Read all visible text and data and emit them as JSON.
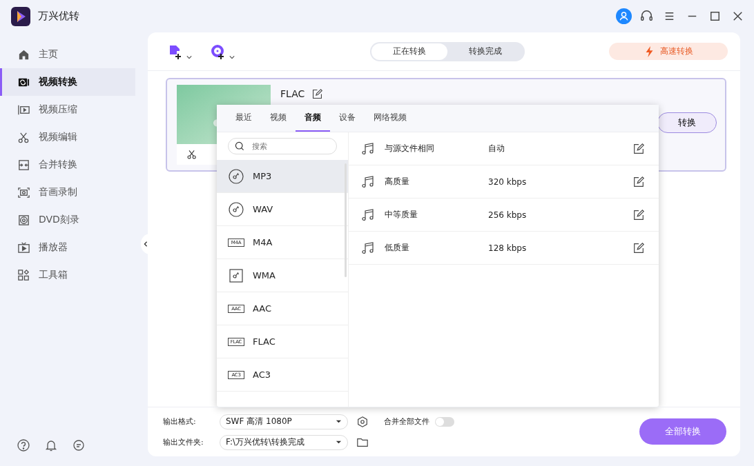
{
  "window": {
    "title": "万兴优转"
  },
  "sidebar": {
    "items": [
      {
        "label": "主页",
        "selected": false
      },
      {
        "label": "视频转换",
        "selected": true
      },
      {
        "label": "视频压缩",
        "selected": false
      },
      {
        "label": "视频编辑",
        "selected": false
      },
      {
        "label": "合并转换",
        "selected": false
      },
      {
        "label": "音画录制",
        "selected": false
      },
      {
        "label": "DVD刻录",
        "selected": false
      },
      {
        "label": "播放器",
        "selected": false
      },
      {
        "label": "工具箱",
        "selected": false
      }
    ]
  },
  "segments": [
    {
      "label": "正在转换",
      "selected": true
    },
    {
      "label": "转换完成",
      "selected": false
    }
  ],
  "turbo_button": "高速转换",
  "file_card": {
    "format": "FLAC",
    "convert_button": "转换"
  },
  "format_popup": {
    "tabs": [
      {
        "label": "最近",
        "selected": false
      },
      {
        "label": "视频",
        "selected": false
      },
      {
        "label": "音频",
        "selected": true
      },
      {
        "label": "设备",
        "selected": false
      },
      {
        "label": "网络视频",
        "selected": false
      }
    ],
    "search": {
      "placeholder": "搜索"
    },
    "formats": [
      {
        "label": "MP3",
        "kind": "disc",
        "selected": true
      },
      {
        "label": "WAV",
        "kind": "disc",
        "selected": false
      },
      {
        "label": "M4A",
        "kind": "tag",
        "tag": "M4A",
        "selected": false
      },
      {
        "label": "WMA",
        "kind": "square",
        "selected": false
      },
      {
        "label": "AAC",
        "kind": "tag",
        "tag": "AAC",
        "selected": false
      },
      {
        "label": "FLAC",
        "kind": "tag",
        "tag": "FLAC",
        "selected": false
      },
      {
        "label": "AC3",
        "kind": "tag",
        "tag": "AC3",
        "selected": false
      }
    ],
    "presets": [
      {
        "name": "与源文件相同",
        "bitrate": "自动"
      },
      {
        "name": "高质量",
        "bitrate": "320 kbps"
      },
      {
        "name": "中等质量",
        "bitrate": "256 kbps"
      },
      {
        "name": "低质量",
        "bitrate": "128 kbps"
      }
    ]
  },
  "bottom": {
    "format_label": "输出格式:",
    "format_value": "SWF 高清 1080P",
    "merge_label": "合并全部文件",
    "merge_on": false,
    "folder_label": "输出文件夹:",
    "folder_value": "F:\\万兴优转\\转换完成",
    "convert_all_button": "全部转换"
  }
}
